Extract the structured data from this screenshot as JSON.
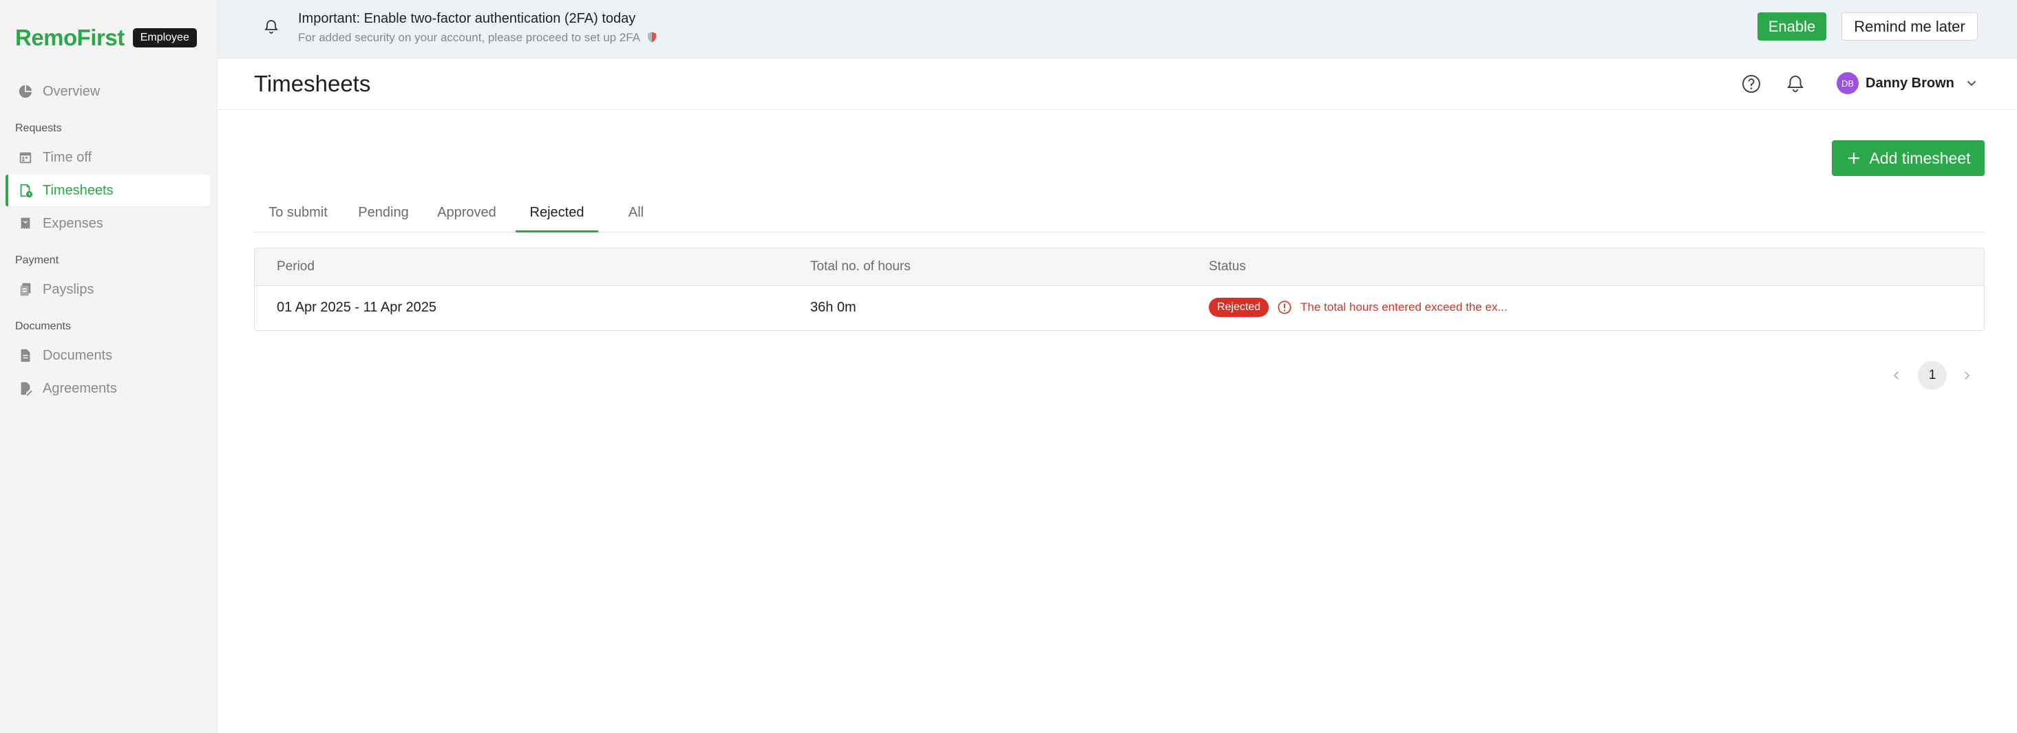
{
  "brand": {
    "logo": "RemoFirst",
    "role": "Employee"
  },
  "sidebar": {
    "overview": "Overview",
    "sections": {
      "requests": "Requests",
      "payment": "Payment",
      "documents": "Documents"
    },
    "items": {
      "time_off": "Time off",
      "timesheets": "Timesheets",
      "expenses": "Expenses",
      "payslips": "Payslips",
      "documents": "Documents",
      "agreements": "Agreements"
    },
    "active": "timesheets"
  },
  "banner": {
    "title": "Important: Enable two-factor authentication (2FA) today",
    "subtitle": "For added security on your account, please proceed to set up 2FA",
    "enable_label": "Enable",
    "remind_label": "Remind me later"
  },
  "header": {
    "title": "Timesheets",
    "user": {
      "initials": "DB",
      "name": "Danny Brown"
    }
  },
  "actions": {
    "add_label": "Add timesheet"
  },
  "tabs": {
    "to_submit": "To submit",
    "pending": "Pending",
    "approved": "Approved",
    "rejected": "Rejected",
    "all": "All",
    "active": "rejected"
  },
  "table": {
    "columns": {
      "period": "Period",
      "hours": "Total no. of hours",
      "status": "Status"
    },
    "rows": [
      {
        "period": "01 Apr 2025 - 11 Apr 2025",
        "hours": "36h 0m",
        "status": "Rejected",
        "reason": "The total hours entered exceed the ex..."
      }
    ]
  },
  "pagination": {
    "current": "1"
  },
  "colors": {
    "accent": "#2aa84a",
    "danger": "#d93025",
    "avatar": "#9b52e0"
  }
}
